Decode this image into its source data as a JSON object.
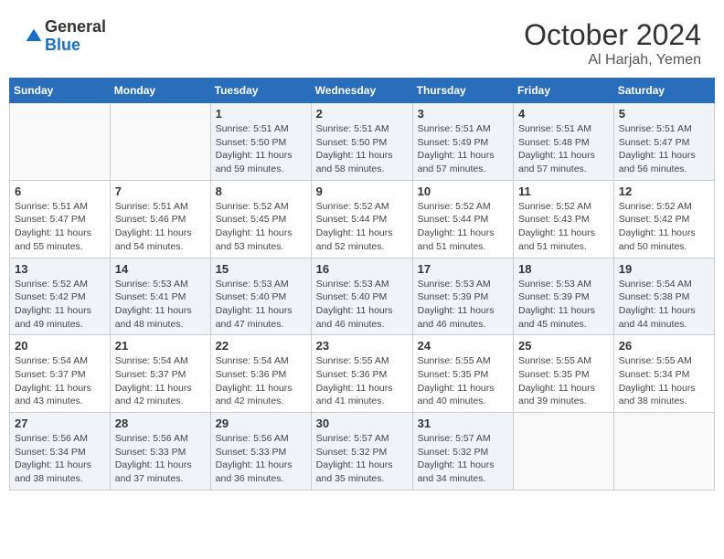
{
  "logo": {
    "general": "General",
    "blue": "Blue"
  },
  "header": {
    "month": "October 2024",
    "location": "Al Harjah, Yemen"
  },
  "weekdays": [
    "Sunday",
    "Monday",
    "Tuesday",
    "Wednesday",
    "Thursday",
    "Friday",
    "Saturday"
  ],
  "weeks": [
    [
      {
        "day": "",
        "info": ""
      },
      {
        "day": "",
        "info": ""
      },
      {
        "day": "1",
        "sunrise": "Sunrise: 5:51 AM",
        "sunset": "Sunset: 5:50 PM",
        "daylight": "Daylight: 11 hours and 59 minutes."
      },
      {
        "day": "2",
        "sunrise": "Sunrise: 5:51 AM",
        "sunset": "Sunset: 5:50 PM",
        "daylight": "Daylight: 11 hours and 58 minutes."
      },
      {
        "day": "3",
        "sunrise": "Sunrise: 5:51 AM",
        "sunset": "Sunset: 5:49 PM",
        "daylight": "Daylight: 11 hours and 57 minutes."
      },
      {
        "day": "4",
        "sunrise": "Sunrise: 5:51 AM",
        "sunset": "Sunset: 5:48 PM",
        "daylight": "Daylight: 11 hours and 57 minutes."
      },
      {
        "day": "5",
        "sunrise": "Sunrise: 5:51 AM",
        "sunset": "Sunset: 5:47 PM",
        "daylight": "Daylight: 11 hours and 56 minutes."
      }
    ],
    [
      {
        "day": "6",
        "sunrise": "Sunrise: 5:51 AM",
        "sunset": "Sunset: 5:47 PM",
        "daylight": "Daylight: 11 hours and 55 minutes."
      },
      {
        "day": "7",
        "sunrise": "Sunrise: 5:51 AM",
        "sunset": "Sunset: 5:46 PM",
        "daylight": "Daylight: 11 hours and 54 minutes."
      },
      {
        "day": "8",
        "sunrise": "Sunrise: 5:52 AM",
        "sunset": "Sunset: 5:45 PM",
        "daylight": "Daylight: 11 hours and 53 minutes."
      },
      {
        "day": "9",
        "sunrise": "Sunrise: 5:52 AM",
        "sunset": "Sunset: 5:44 PM",
        "daylight": "Daylight: 11 hours and 52 minutes."
      },
      {
        "day": "10",
        "sunrise": "Sunrise: 5:52 AM",
        "sunset": "Sunset: 5:44 PM",
        "daylight": "Daylight: 11 hours and 51 minutes."
      },
      {
        "day": "11",
        "sunrise": "Sunrise: 5:52 AM",
        "sunset": "Sunset: 5:43 PM",
        "daylight": "Daylight: 11 hours and 51 minutes."
      },
      {
        "day": "12",
        "sunrise": "Sunrise: 5:52 AM",
        "sunset": "Sunset: 5:42 PM",
        "daylight": "Daylight: 11 hours and 50 minutes."
      }
    ],
    [
      {
        "day": "13",
        "sunrise": "Sunrise: 5:52 AM",
        "sunset": "Sunset: 5:42 PM",
        "daylight": "Daylight: 11 hours and 49 minutes."
      },
      {
        "day": "14",
        "sunrise": "Sunrise: 5:53 AM",
        "sunset": "Sunset: 5:41 PM",
        "daylight": "Daylight: 11 hours and 48 minutes."
      },
      {
        "day": "15",
        "sunrise": "Sunrise: 5:53 AM",
        "sunset": "Sunset: 5:40 PM",
        "daylight": "Daylight: 11 hours and 47 minutes."
      },
      {
        "day": "16",
        "sunrise": "Sunrise: 5:53 AM",
        "sunset": "Sunset: 5:40 PM",
        "daylight": "Daylight: 11 hours and 46 minutes."
      },
      {
        "day": "17",
        "sunrise": "Sunrise: 5:53 AM",
        "sunset": "Sunset: 5:39 PM",
        "daylight": "Daylight: 11 hours and 46 minutes."
      },
      {
        "day": "18",
        "sunrise": "Sunrise: 5:53 AM",
        "sunset": "Sunset: 5:39 PM",
        "daylight": "Daylight: 11 hours and 45 minutes."
      },
      {
        "day": "19",
        "sunrise": "Sunrise: 5:54 AM",
        "sunset": "Sunset: 5:38 PM",
        "daylight": "Daylight: 11 hours and 44 minutes."
      }
    ],
    [
      {
        "day": "20",
        "sunrise": "Sunrise: 5:54 AM",
        "sunset": "Sunset: 5:37 PM",
        "daylight": "Daylight: 11 hours and 43 minutes."
      },
      {
        "day": "21",
        "sunrise": "Sunrise: 5:54 AM",
        "sunset": "Sunset: 5:37 PM",
        "daylight": "Daylight: 11 hours and 42 minutes."
      },
      {
        "day": "22",
        "sunrise": "Sunrise: 5:54 AM",
        "sunset": "Sunset: 5:36 PM",
        "daylight": "Daylight: 11 hours and 42 minutes."
      },
      {
        "day": "23",
        "sunrise": "Sunrise: 5:55 AM",
        "sunset": "Sunset: 5:36 PM",
        "daylight": "Daylight: 11 hours and 41 minutes."
      },
      {
        "day": "24",
        "sunrise": "Sunrise: 5:55 AM",
        "sunset": "Sunset: 5:35 PM",
        "daylight": "Daylight: 11 hours and 40 minutes."
      },
      {
        "day": "25",
        "sunrise": "Sunrise: 5:55 AM",
        "sunset": "Sunset: 5:35 PM",
        "daylight": "Daylight: 11 hours and 39 minutes."
      },
      {
        "day": "26",
        "sunrise": "Sunrise: 5:55 AM",
        "sunset": "Sunset: 5:34 PM",
        "daylight": "Daylight: 11 hours and 38 minutes."
      }
    ],
    [
      {
        "day": "27",
        "sunrise": "Sunrise: 5:56 AM",
        "sunset": "Sunset: 5:34 PM",
        "daylight": "Daylight: 11 hours and 38 minutes."
      },
      {
        "day": "28",
        "sunrise": "Sunrise: 5:56 AM",
        "sunset": "Sunset: 5:33 PM",
        "daylight": "Daylight: 11 hours and 37 minutes."
      },
      {
        "day": "29",
        "sunrise": "Sunrise: 5:56 AM",
        "sunset": "Sunset: 5:33 PM",
        "daylight": "Daylight: 11 hours and 36 minutes."
      },
      {
        "day": "30",
        "sunrise": "Sunrise: 5:57 AM",
        "sunset": "Sunset: 5:32 PM",
        "daylight": "Daylight: 11 hours and 35 minutes."
      },
      {
        "day": "31",
        "sunrise": "Sunrise: 5:57 AM",
        "sunset": "Sunset: 5:32 PM",
        "daylight": "Daylight: 11 hours and 34 minutes."
      },
      {
        "day": "",
        "info": ""
      },
      {
        "day": "",
        "info": ""
      }
    ]
  ]
}
